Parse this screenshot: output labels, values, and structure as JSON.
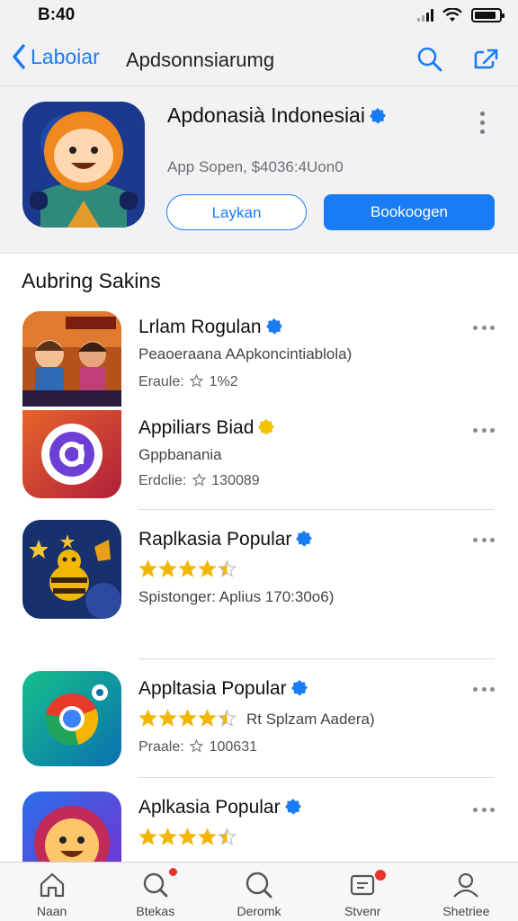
{
  "status_bar": {
    "time": "B:40"
  },
  "nav": {
    "back_label": "Laboiar",
    "title": "Apdsonnsiarumg",
    "actions": [
      "search-icon",
      "share-icon"
    ]
  },
  "featured": {
    "name": "Apdonasià Indonesiai",
    "subtitle": "App Sopen, $4036:4Uon0",
    "secondary_button": "Laykan",
    "primary_button": "Bookoogen"
  },
  "section": {
    "title": "Aubring Sakins"
  },
  "apps": [
    {
      "name": "Lrlam Rogulan",
      "line2": "Peaoeraana AApkoncintiablola)",
      "line3_prefix": "Eraule:",
      "line3_value": "1%2",
      "verified_color": "#1a7cf4"
    },
    {
      "name": "Appiliars Biad",
      "line2": "Gppbanania",
      "line3_prefix": "Erdclie:",
      "line3_value": "130089",
      "verified_color": "#f2c200"
    },
    {
      "name": "Raplkasia Popular",
      "rating": 4.5,
      "line3_full": "Spistonger: Aplius 170:30o6)",
      "verified_color": "#1a7cf4"
    },
    {
      "name": "Appltasia Popular",
      "rating": 4.5,
      "line2_inline": "Rt Splzam Aadera)",
      "line3_prefix": "Praale:",
      "line3_value": "100631",
      "verified_color": "#1a7cf4"
    },
    {
      "name": "Aplkasia Popular",
      "rating": 4.5,
      "verified_color": "#1a7cf4"
    }
  ],
  "tabs": [
    {
      "label": "Naan",
      "icon": "home-icon"
    },
    {
      "label": "Btekas",
      "icon": "search-badge-icon"
    },
    {
      "label": "Deromk",
      "icon": "search-icon"
    },
    {
      "label": "Stvenr",
      "icon": "inbox-icon"
    },
    {
      "label": "Shetriee",
      "icon": "profile-icon"
    }
  ],
  "colors": {
    "accent": "#1a7cf4",
    "star": "#f2b705",
    "badge": "#e8342b"
  }
}
